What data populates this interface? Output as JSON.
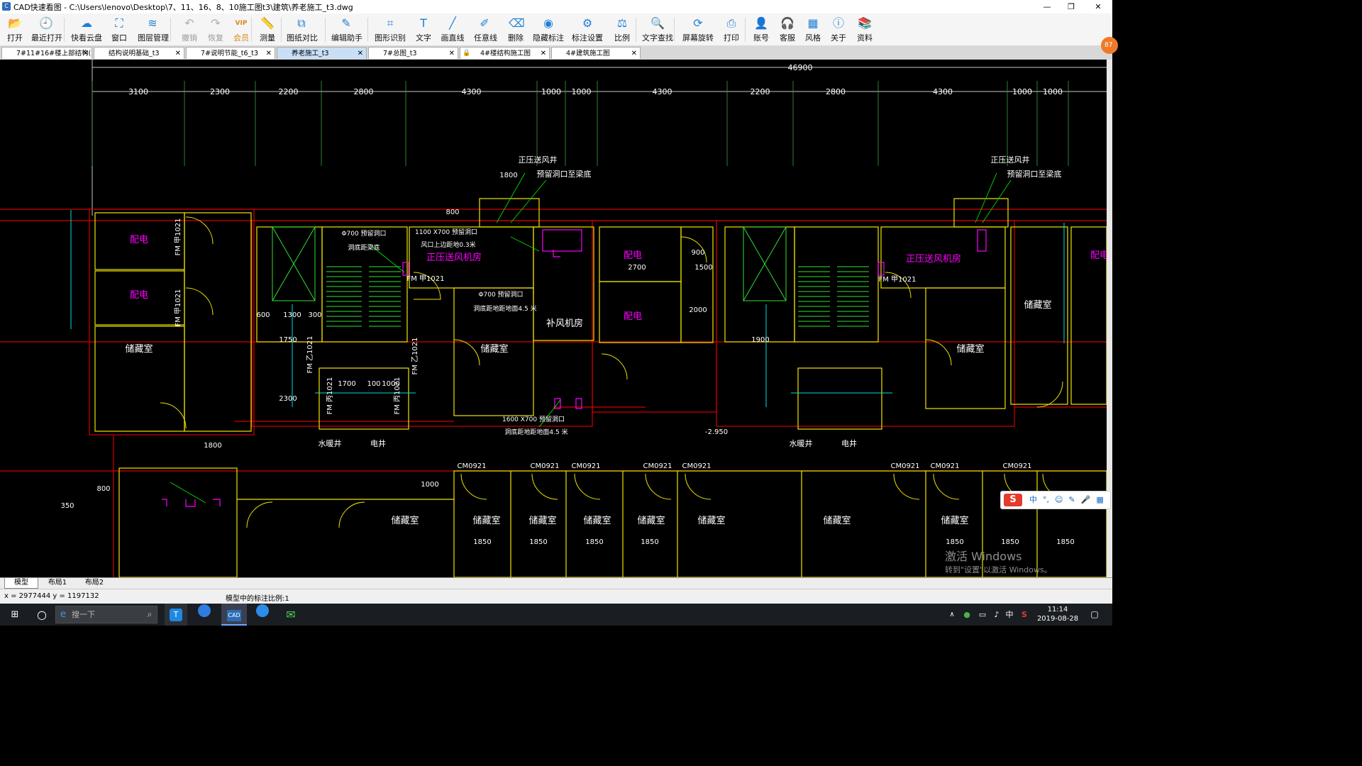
{
  "window": {
    "title": "CAD快速看图 - C:\\Users\\lenovo\\Desktop\\7、11、16、8、10施工图t3\\建筑\\养老施工_t3.dwg",
    "app_icon": "cad-app-icon",
    "controls": {
      "minimize": "—",
      "restore": "❐",
      "close": "✕"
    }
  },
  "toolbar": {
    "items": [
      {
        "label": "打开",
        "icon": "folder-open-icon",
        "glyph": "📂"
      },
      {
        "label": "最近打开",
        "icon": "history-icon",
        "glyph": "🕘"
      },
      {
        "label": "快看云盘",
        "icon": "cloud-icon",
        "glyph": "☁"
      },
      {
        "label": "窗口",
        "icon": "window-icon",
        "glyph": "⛶"
      },
      {
        "label": "图层管理",
        "icon": "layers-icon",
        "glyph": "≋"
      },
      {
        "label": "撤销",
        "icon": "undo-icon",
        "glyph": "↶"
      },
      {
        "label": "恢复",
        "icon": "redo-icon",
        "glyph": "↷"
      },
      {
        "label": "会员",
        "icon": "vip-icon",
        "glyph": "VIP"
      },
      {
        "label": "测量",
        "icon": "ruler-icon",
        "glyph": "📏"
      },
      {
        "label": "图纸对比",
        "icon": "compare-icon",
        "glyph": "⧉"
      },
      {
        "label": "编辑助手",
        "icon": "edit-assistant-icon",
        "glyph": "✎"
      },
      {
        "label": "图形识别",
        "icon": "shape-recognition-icon",
        "glyph": "⌗"
      },
      {
        "label": "文字",
        "icon": "text-icon",
        "glyph": "T"
      },
      {
        "label": "画直线",
        "icon": "line-icon",
        "glyph": "╱"
      },
      {
        "label": "任意线",
        "icon": "freehand-icon",
        "glyph": "✐"
      },
      {
        "label": "删除",
        "icon": "eraser-icon",
        "glyph": "⌫"
      },
      {
        "label": "隐藏标注",
        "icon": "hide-annotation-icon",
        "glyph": "◉"
      },
      {
        "label": "标注设置",
        "icon": "annotation-settings-icon",
        "glyph": "⚙"
      },
      {
        "label": "比例",
        "icon": "scale-icon",
        "glyph": "⚖"
      },
      {
        "label": "文字查找",
        "icon": "text-search-icon",
        "glyph": "🔍"
      },
      {
        "label": "屏幕旋转",
        "icon": "rotate-icon",
        "glyph": "⟳"
      },
      {
        "label": "打印",
        "icon": "print-icon",
        "glyph": "⎙"
      },
      {
        "label": "账号",
        "icon": "account-icon",
        "glyph": "👤"
      },
      {
        "label": "客服",
        "icon": "headset-icon",
        "glyph": "🎧"
      },
      {
        "label": "风格",
        "icon": "style-icon",
        "glyph": "▦"
      },
      {
        "label": "关于",
        "icon": "info-icon",
        "glyph": "ⓘ"
      },
      {
        "label": "资料",
        "icon": "docs-icon",
        "glyph": "📚"
      }
    ]
  },
  "tabs": [
    {
      "label": "7#11#16#楼上部结构(…",
      "active": false
    },
    {
      "label": "结构说明基础_t3",
      "active": false
    },
    {
      "label": "7#说明节能_t6_t3",
      "active": false
    },
    {
      "label": "养老施工_t3",
      "active": true
    },
    {
      "label": "7#总图_t3",
      "active": false
    },
    {
      "label": "4#楼结构施工图",
      "active": false
    },
    {
      "label": "4#建筑施工图",
      "active": false
    }
  ],
  "tab_close": "✕",
  "notification_badge": "87",
  "drawing": {
    "overall_dim": "46900",
    "bay_dims": [
      "3100",
      "2300",
      "2200",
      "2800",
      "4300",
      "1000",
      "1000",
      "4300",
      "2200",
      "2800",
      "4300",
      "1000",
      "1000"
    ],
    "room_labels": [
      "配电",
      "配电",
      "储藏室",
      "正压送风机房",
      "补风机房",
      "配电",
      "配电",
      "储藏室",
      "正压送风机房",
      "储藏室",
      "配电",
      "储藏室",
      "储藏室",
      "储藏室",
      "储藏室",
      "储藏室",
      "储藏室",
      "储藏室",
      "储藏室",
      "储藏室"
    ],
    "shaft_labels": [
      "正压送风井",
      "预留洞口至梁底",
      "正压送风井",
      "预留洞口至梁底",
      "水暖井",
      "电井",
      "水暖井",
      "电井"
    ],
    "door_labels": [
      "FM 甲1021",
      "FM 甲1021",
      "FM 甲1021",
      "FM 甲1021",
      "FM 乙1021",
      "FM 乙1021",
      "FM 丙1021",
      "FM 丙1021",
      "CM0921",
      "CM0921",
      "CM0921",
      "CM0921",
      "CM0921",
      "CM0921",
      "CM0921",
      "CM0921"
    ],
    "dim_labels": [
      "1800",
      "800",
      "600",
      "1300",
      "300",
      "1700",
      "100",
      "1000",
      "1800",
      "800",
      "350",
      "1000",
      "1850",
      "1850",
      "1850",
      "1850",
      "1850",
      "1850",
      "1850",
      "2700",
      "1500",
      "900",
      "2000",
      "1750",
      "2300",
      "1900",
      "-2.950"
    ],
    "notes": [
      "Φ700 预留洞口",
      "洞底距梁底",
      "1100 X700 预留洞口",
      "风口上边距地0.3米",
      "Φ700 预留洞口",
      "洞底距地距地面4.5 米",
      "1600 X700 预留洞口",
      "洞底距地距地面4.5 米"
    ]
  },
  "layout_tabs": [
    {
      "label": "模型",
      "active": true
    },
    {
      "label": "布局1",
      "active": false
    },
    {
      "label": "布局2",
      "active": false
    }
  ],
  "status": {
    "coords": "x = 2977444  y = 1197132",
    "scale_text": "模型中的标注比例:1"
  },
  "watermark": {
    "line1": "激活 Windows",
    "line2": "转到\"设置\"以激活 Windows。"
  },
  "ime_bar": {
    "items": [
      "中",
      "°,",
      "☺",
      "✎",
      "🎤",
      "▦"
    ]
  },
  "taskbar": {
    "search_placeholder": "搜一下",
    "clock_time": "11:14",
    "clock_date": "2019-08-28",
    "tray_lang": "中"
  },
  "colors": {
    "wall_yellow": "#f0e400",
    "axis_red": "#d40000",
    "dim_grey": "#c8c8c8",
    "stair_green": "#33e033",
    "label_magenta": "#ff00ff",
    "text_white": "#ffffff",
    "cyan": "#00e0e0"
  }
}
